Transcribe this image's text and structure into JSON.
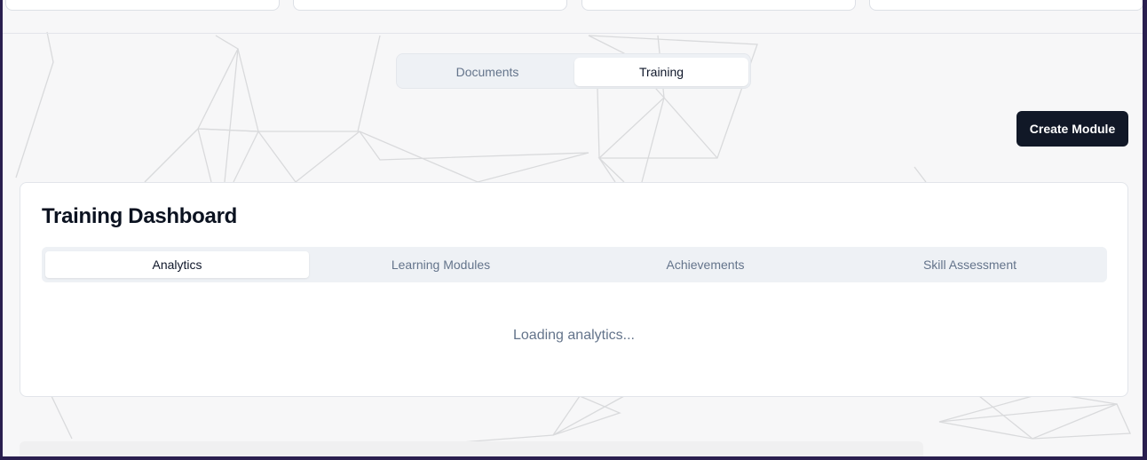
{
  "view_switch": {
    "items": [
      {
        "label": "Documents",
        "active": false
      },
      {
        "label": "Training",
        "active": true
      }
    ]
  },
  "toolbar": {
    "create_label": "Create Module"
  },
  "dashboard": {
    "title": "Training Dashboard",
    "tabs": [
      {
        "label": "Analytics",
        "active": true
      },
      {
        "label": "Learning Modules",
        "active": false
      },
      {
        "label": "Achievements",
        "active": false
      },
      {
        "label": "Skill Assessment",
        "active": false
      }
    ],
    "loading_text": "Loading analytics..."
  },
  "colors": {
    "primary_button": "#111827",
    "window_frame": "#2a1f4f",
    "muted_text": "#64748b"
  }
}
